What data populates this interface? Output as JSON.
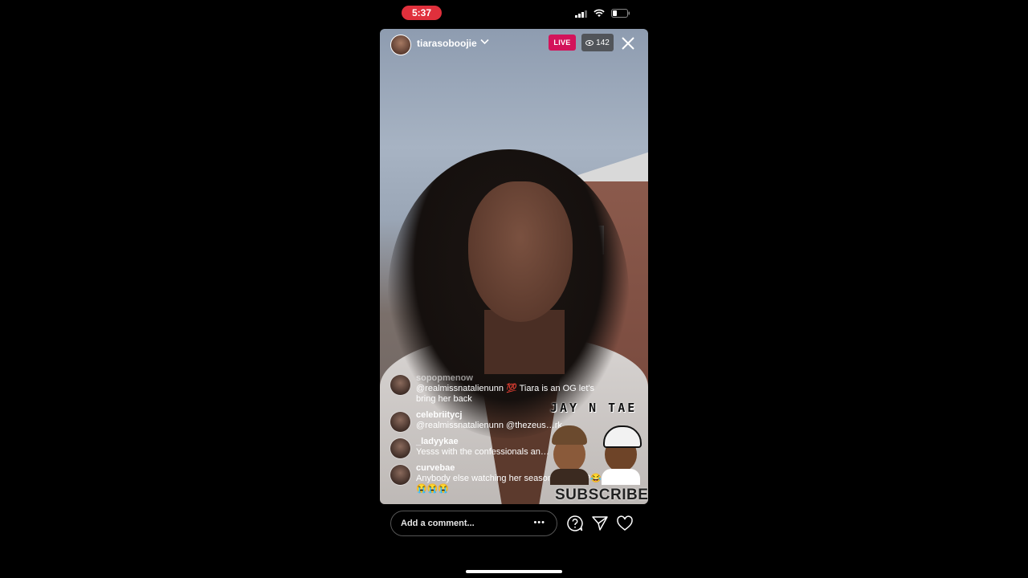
{
  "status_bar": {
    "time": "5:37"
  },
  "header": {
    "host_username": "tiarasoboojie",
    "live_label": "LIVE",
    "viewer_count": "142"
  },
  "comments": [
    {
      "username": "sopopmenow",
      "text": "@realmissnatalienunn 💯 Tiara is an OG let's bring her back"
    },
    {
      "username": "celebriitycj",
      "text": "@realmissnatalienunn @thezeus…rk"
    },
    {
      "username": "_ladyykae",
      "text": "Yesss with the confessionals an…"
    },
    {
      "username": "curvebae",
      "text": "Anybody else watching her season on Hulu?😂 😭😭😭"
    }
  ],
  "watermark": {
    "title": "JAY N TAE",
    "cta": "SUBSCRIBE"
  },
  "footer": {
    "comment_placeholder": "Add a comment...",
    "more_label": "•••"
  },
  "icons": {
    "close": "close-icon",
    "question": "question-icon",
    "share": "send-icon",
    "like": "heart-icon"
  },
  "colors": {
    "live": "#d3135a",
    "time_pill": "#e0303c"
  }
}
